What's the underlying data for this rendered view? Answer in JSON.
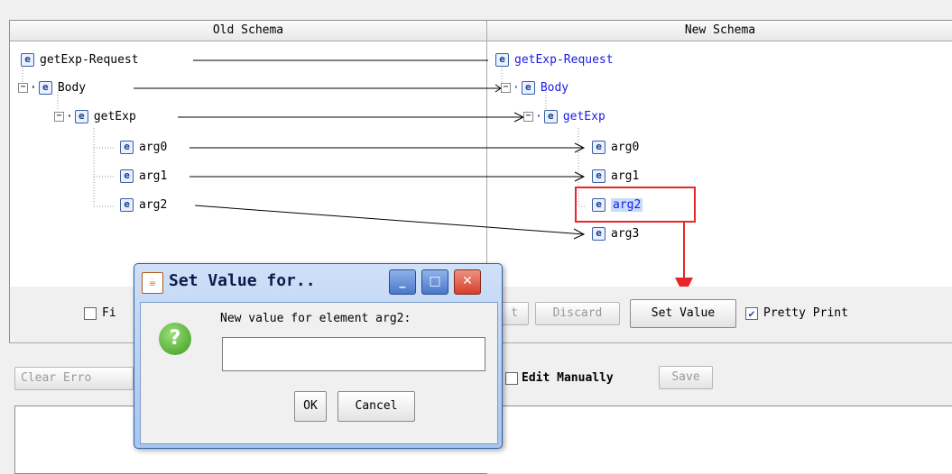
{
  "schemas": {
    "old_header": "Old Schema",
    "new_header": "New Schema"
  },
  "old_tree": {
    "request": "getExp-Request",
    "body": "Body",
    "getexp": "getExp",
    "arg0": "arg0",
    "arg1": "arg1",
    "arg2": "arg2"
  },
  "new_tree": {
    "request": "getExp-Request",
    "body": "Body",
    "getexp": "getExp",
    "arg0": "arg0",
    "arg1": "arg1",
    "arg2": "arg2",
    "arg3": "arg3"
  },
  "element_icon": "e",
  "toolbar": {
    "filter_label": "Fi",
    "partial_button": "t",
    "discard_button": "Discard",
    "set_value_button": "Set Value",
    "pretty_print_label": "Pretty Print",
    "pretty_print_checked": true
  },
  "bottom_toolbar": {
    "clear_errors_button": "Clear Erro",
    "edit_manually_label": "Edit Manually",
    "save_button": "Save"
  },
  "dialog": {
    "title": "Set Value for..",
    "prompt": "New value for element arg2:",
    "input_value": "",
    "ok_button": "OK",
    "cancel_button": "Cancel",
    "icon": "question-icon",
    "question_glyph": "?"
  },
  "colors": {
    "highlight_box": "#e8262a",
    "link_text": "#1a1ae6",
    "dialog_frame": "#2e5fa9"
  }
}
